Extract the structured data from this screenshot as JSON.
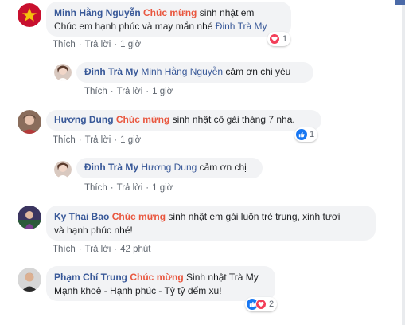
{
  "comments": [
    {
      "author": "Minh Hằng Nguyễn",
      "highlight": "Chúc mừng",
      "text_1": " sinh nhật em",
      "text_2": "Chúc em hạnh phúc và may mắn nhé ",
      "mention": "Đinh Trà My",
      "like_label": "Thích",
      "reply_label": "Trả lời",
      "time": "1 giờ",
      "reaction_count": "1",
      "reactions": [
        "love-icon"
      ]
    },
    {
      "author": "Đinh Trà My",
      "mention": "Minh Hằng Nguyễn",
      "text": " cảm ơn chị yêu",
      "like_label": "Thích",
      "reply_label": "Trả lời",
      "time": "1 giờ"
    },
    {
      "author": "Hương Dung",
      "highlight": "Chúc mừng",
      "text": " sinh nhật cô gái tháng 7 nha.",
      "like_label": "Thích",
      "reply_label": "Trả lời",
      "time": "1 giờ",
      "reaction_count": "1",
      "reactions": [
        "like-icon"
      ]
    },
    {
      "author": "Đinh Trà My",
      "mention": "Hương Dung",
      "text": " cảm ơn chị",
      "like_label": "Thích",
      "reply_label": "Trả lời",
      "time": "1 giờ"
    },
    {
      "author": "Ky Thai Bao",
      "highlight": "Chúc mừng",
      "text_1": " sinh nhật em gái luôn trẻ trung, xinh tươi",
      "text_2": "và hạnh phúc nhé!",
      "like_label": "Thích",
      "reply_label": "Trả lời",
      "time": "42 phút"
    },
    {
      "author": "Phạm Chí Trung",
      "highlight": "Chúc mừng",
      "text_1": " Sinh nhật Trà My",
      "text_2": "Mạnh khoẻ - Hạnh phúc - Tỷ tỷ đếm xu!",
      "reaction_count": "2",
      "reactions": [
        "like-icon",
        "love-icon"
      ]
    }
  ],
  "colors": {
    "name": "#385898",
    "highlight": "#e9573f",
    "bubble": "#f2f3f5",
    "like": "#1877f2",
    "love": "#f33e58"
  }
}
